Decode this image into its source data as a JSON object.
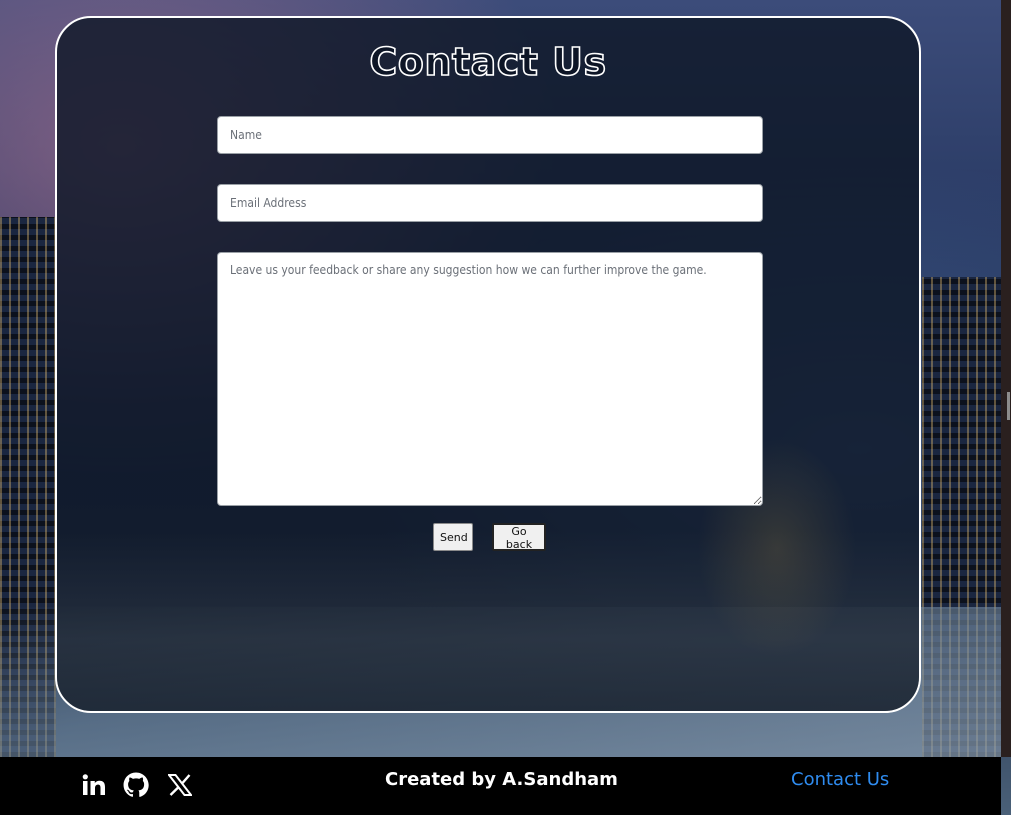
{
  "page": {
    "title": "Contact Us"
  },
  "form": {
    "name_placeholder": "Name",
    "email_placeholder": "Email Address",
    "feedback_placeholder": "Leave us your feedback or share any suggestion how we can further improve the game.",
    "send_label": "Send",
    "back_label": "Go back"
  },
  "footer": {
    "social": [
      "linkedin-icon",
      "github-icon",
      "x-icon"
    ],
    "credit": "Created by A.Sandham",
    "contact_link": "Contact Us"
  },
  "colors": {
    "footer_background": "#000000",
    "link": "#2f8cf0",
    "panel_border": "#ffffff"
  }
}
